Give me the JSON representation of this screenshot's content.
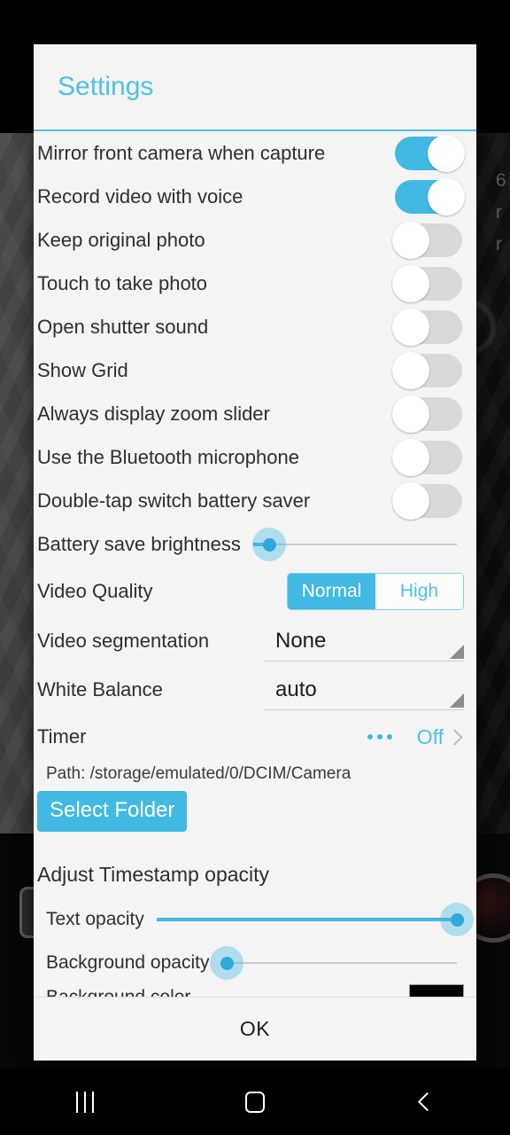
{
  "dialog": {
    "title": "Settings",
    "ok_label": "OK"
  },
  "toggles": [
    {
      "label": "Mirror front camera when capture",
      "state": "on"
    },
    {
      "label": "Record video with voice",
      "state": "on"
    },
    {
      "label": "Keep original photo",
      "state": "off"
    },
    {
      "label": "Touch to take photo",
      "state": "off"
    },
    {
      "label": "Open shutter sound",
      "state": "off"
    },
    {
      "label": "Show Grid",
      "state": "off"
    },
    {
      "label": "Always display zoom slider",
      "state": "off"
    },
    {
      "label": "Use the Bluetooth microphone",
      "state": "off"
    },
    {
      "label": "Double-tap switch battery saver",
      "state": "off"
    }
  ],
  "brightness": {
    "label": "Battery save brightness",
    "value_percent": 8
  },
  "video_quality": {
    "label": "Video Quality",
    "options": [
      "Normal",
      "High"
    ],
    "selected": "Normal"
  },
  "video_segmentation": {
    "label": "Video segmentation",
    "value": "None"
  },
  "white_balance": {
    "label": "White Balance",
    "value": "auto"
  },
  "timer": {
    "label": "Timer",
    "value": "Off",
    "more_icon": "ellipsis-icon",
    "chevron_icon": "chevron-right-icon"
  },
  "storage": {
    "path_text": "Path: /storage/emulated/0/DCIM/Camera",
    "select_folder_label": "Select Folder"
  },
  "timestamp": {
    "section_title": "Adjust Timestamp opacity",
    "text_opacity": {
      "label": "Text opacity",
      "value_percent": 100
    },
    "background_opacity": {
      "label": "Background opacity",
      "value_percent": 2
    },
    "background_color": {
      "label": "Background color",
      "value_hex": "#000000"
    }
  },
  "navbar": {
    "recents_label": "recents-icon",
    "home_label": "home-icon",
    "back_label": "back-icon"
  },
  "background": {
    "ghost_text": "6\nr\nr"
  },
  "colors": {
    "accent": "#41b9e3",
    "title": "#4fc0e8",
    "dialog_bg": "#f4f4f4",
    "text": "#2e2e2e",
    "track_off": "#d9d9d9"
  }
}
